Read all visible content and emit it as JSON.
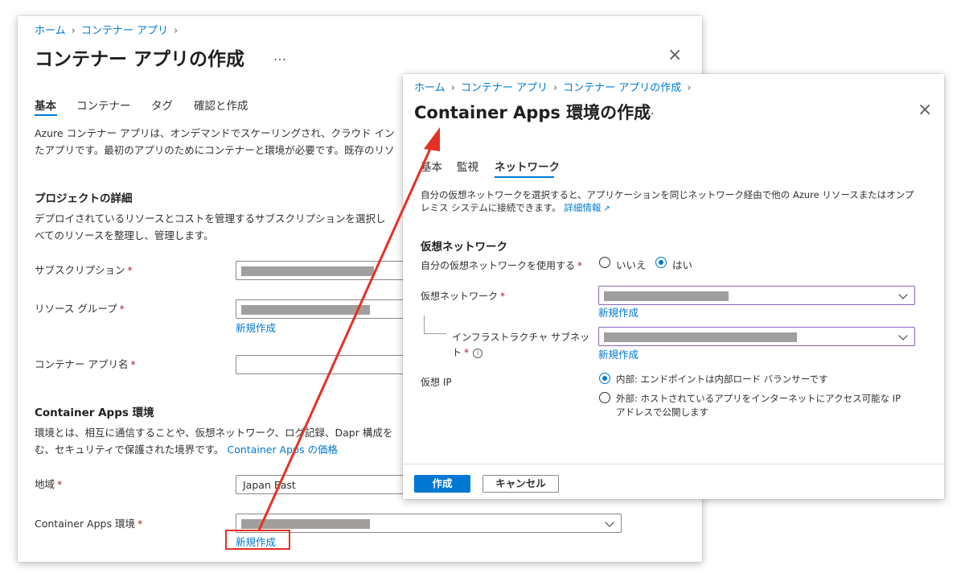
{
  "back": {
    "breadcrumb": [
      "ホーム",
      "コンテナー アプリ"
    ],
    "title": "コンテナー アプリの作成",
    "ellipsis": "…",
    "close": "×",
    "tabs": [
      "基本",
      "コンテナー",
      "タグ",
      "確認と作成"
    ],
    "intro_line1": "Azure コンテナー アプリは、オンデマンドでスケーリングされ、クラウド イン",
    "intro_line2": "たアプリです。最初のアプリのためにコンテナーと環境が必要です。既存のリソ",
    "project_heading": "プロジェクトの詳細",
    "project_line1": "デプロイされているリソースとコストを管理するサブスクリプションを選択し",
    "project_line2": "べてのリソースを整理し、管理します。",
    "subscription_label": "サブスクリプション",
    "resource_group_label": "リソース グループ",
    "new_create": "新規作成",
    "app_name_label": "コンテナー アプリ名",
    "env_heading": "Container Apps 環境",
    "env_line1": "環境とは、相互に通信することや、仮想ネットワーク、ログ記録、Dapr 構成を",
    "env_line2": "む、セキュリティで保護された境界です。",
    "env_price_link": "Container Apps の価格",
    "region_label": "地域",
    "region_value": "Japan East",
    "env_label": "Container Apps 環境",
    "required": "*"
  },
  "front": {
    "breadcrumb": [
      "ホーム",
      "コンテナー アプリ",
      "コンテナー アプリの作成"
    ],
    "title": "Container Apps 環境の作成",
    "ellipsis": "…",
    "close": "×",
    "tabs": [
      "基本",
      "監視",
      "ネットワーク"
    ],
    "desc_line1": "自分の仮想ネットワークを選択すると、アプリケーションを同じネットワーク経由で他の Azure リソースまたはオンプ",
    "desc_line2": "レミス システムに接続できます。",
    "learn_more": "詳細情報",
    "vnet_heading": "仮想ネットワーク",
    "use_own_vnet_label": "自分の仮想ネットワークを使用する",
    "radio_no": "いいえ",
    "radio_yes": "はい",
    "vnet_label": "仮想ネットワーク",
    "new_create": "新規作成",
    "subnet_label_line1": "インフラストラクチャ サブネッ",
    "subnet_label_line2": "ト",
    "virtual_ip_label": "仮想 IP",
    "ip_internal": "内部: エンドポイントは内部ロード バランサーです",
    "ip_external_line1": "外部: ホストされているアプリをインターネットにアクセス可能な IP",
    "ip_external_line2": "アドレスで公開します",
    "create_button": "作成",
    "cancel_button": "キャンセル",
    "required": "*",
    "info_icon_glyph": "i",
    "external_link_glyph": "↗"
  },
  "colors": {
    "accent": "#0078d4",
    "annotation": "#e53124",
    "required": "#a4262c"
  }
}
